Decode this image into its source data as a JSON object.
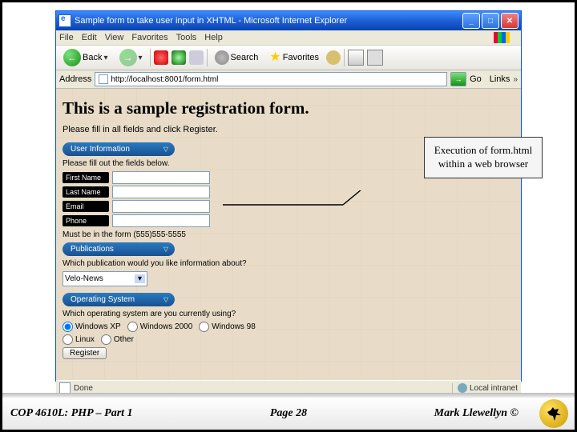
{
  "window": {
    "title": "Sample form to take user input in XHTML - Microsoft Internet Explorer"
  },
  "menubar": {
    "file": "File",
    "edit": "Edit",
    "view": "View",
    "favorites": "Favorites",
    "tools": "Tools",
    "help": "Help"
  },
  "toolbar": {
    "back": "Back",
    "search": "Search",
    "favorites": "Favorites"
  },
  "address": {
    "label": "Address",
    "url": "http://localhost:8001/form.html",
    "go": "Go",
    "links": "Links"
  },
  "page": {
    "heading": "This is a sample registration form.",
    "instruction": "Please fill in all fields and click Register.",
    "section_user": "User Information",
    "user_sub": "Please fill out the fields below.",
    "labels": {
      "first": "First Name",
      "last": "Last Name",
      "email": "Email",
      "phone": "Phone"
    },
    "phone_hint": "Must be in the form (555)555-5555",
    "section_pub": "Publications",
    "pub_q": "Which publication would you like information about?",
    "pub_select": "Velo-News",
    "section_os": "Operating System",
    "os_q": "Which operating system are you currently using?",
    "os_opts": [
      "Windows XP",
      "Windows 2000",
      "Windows 98",
      "Linux",
      "Other"
    ],
    "register_btn": "Register"
  },
  "statusbar": {
    "done": "Done",
    "zone": "Local intranet"
  },
  "callout": {
    "text": "Execution of form.html within a web browser"
  },
  "footer": {
    "left": "COP 4610L: PHP – Part 1",
    "center": "Page 28",
    "right": "Mark Llewellyn ©"
  }
}
